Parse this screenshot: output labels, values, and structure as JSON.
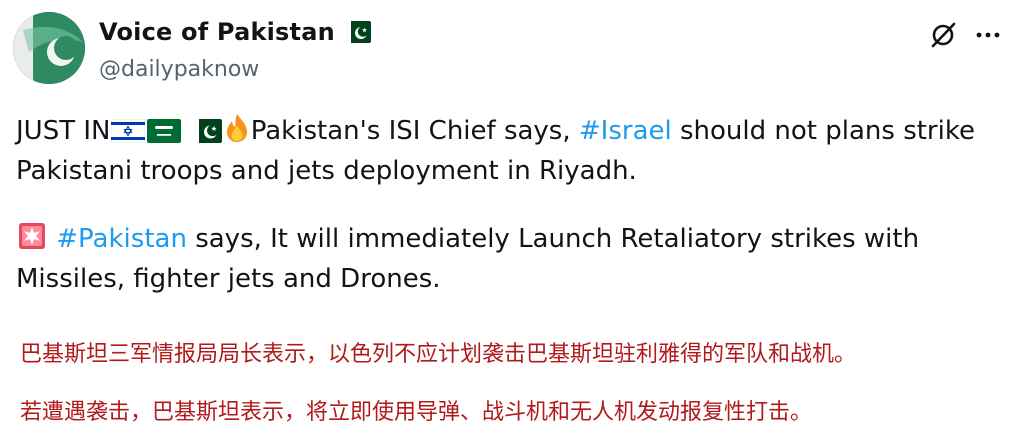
{
  "author": {
    "display_name": "Voice of Pakistan",
    "handle": "@dailypaknow",
    "avatar_icon": "pakistan-flag-avatar",
    "verified_flag_icon": "pakistan-flag-icon"
  },
  "actions": {
    "grok_icon": "grok-icon",
    "more_icon": "more-options-icon"
  },
  "tweet": {
    "paragraph1": {
      "prefix": "JUST IN",
      "emojis": [
        "israel-flag-icon",
        "saudi-flag-icon",
        "pakistan-flag-icon",
        "fire-icon"
      ],
      "text_before_tag": "Pakistan's ISI Chief says, ",
      "hashtag": "#Israel",
      "text_after_tag": " should not plans strike Pakistani troops and jets deployment in Riyadh."
    },
    "paragraph2": {
      "emoji": "siren-icon",
      "hashtag": "#Pakistan",
      "text_after_tag": " says, It will immediately Launch Retaliatory strikes with Missiles, fighter jets and Drones."
    }
  },
  "translation": {
    "line1": "巴基斯坦三军情报局局长表示，以色列不应计划袭击巴基斯坦驻利雅得的军队和战机。",
    "line2": "若遭遇袭击，巴基斯坦表示，将立即使用导弹、战斗机和无人机发动报复性打击。"
  },
  "colors": {
    "text": "#0f1419",
    "secondary": "#536471",
    "link": "#1d9bf0",
    "translation": "#b21a1a",
    "pakistan_green": "#01411c"
  }
}
